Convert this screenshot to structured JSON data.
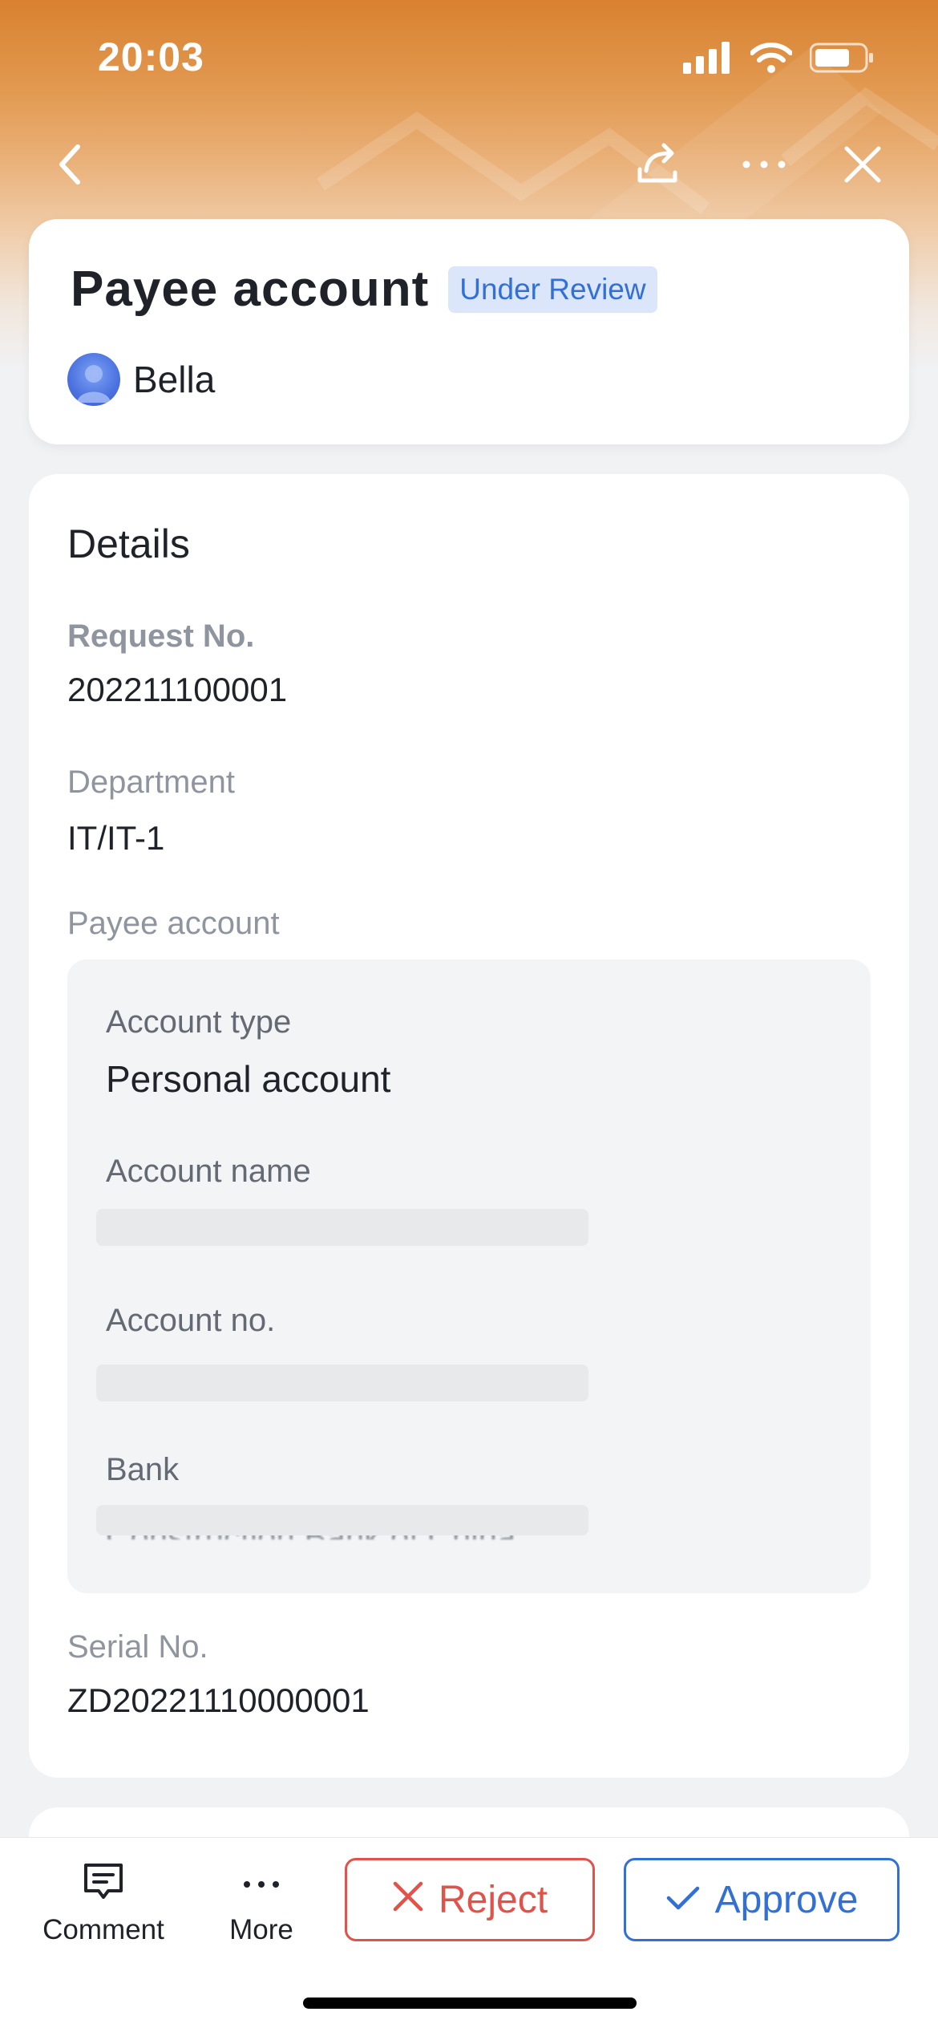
{
  "status_bar": {
    "time": "20:03"
  },
  "header": {
    "title": "Payee account",
    "status_badge": "Under Review",
    "applicant": "Bella"
  },
  "details": {
    "section_title": "Details",
    "request_no_label": "Request No.",
    "request_no": "202211100001",
    "department_label": "Department",
    "department": "IT/IT-1",
    "payee_account_label": "Payee account",
    "payee": {
      "account_type_label": "Account type",
      "account_type": "Personal account",
      "account_name_label": "Account name",
      "account_no_label": "Account no.",
      "bank_label": "Bank",
      "bank_value": "Construction Bank of China"
    },
    "serial_no_label": "Serial No.",
    "serial_no": "ZD20221110000001"
  },
  "actions": {
    "comment_label": "Comment",
    "more_label": "More",
    "reject_label": "Reject",
    "approve_label": "Approve"
  },
  "colors": {
    "header_orange": "#d9812f",
    "badge_bg": "#dbe6fb",
    "accent_blue": "#3370d4",
    "reject_red": "#e0524a"
  },
  "icons": [
    "back-icon",
    "share-icon",
    "more-horizontal-icon",
    "close-icon",
    "comment-icon",
    "more-icon",
    "reject-x-icon",
    "approve-check-icon",
    "signal-icon",
    "wifi-icon",
    "battery-icon"
  ]
}
